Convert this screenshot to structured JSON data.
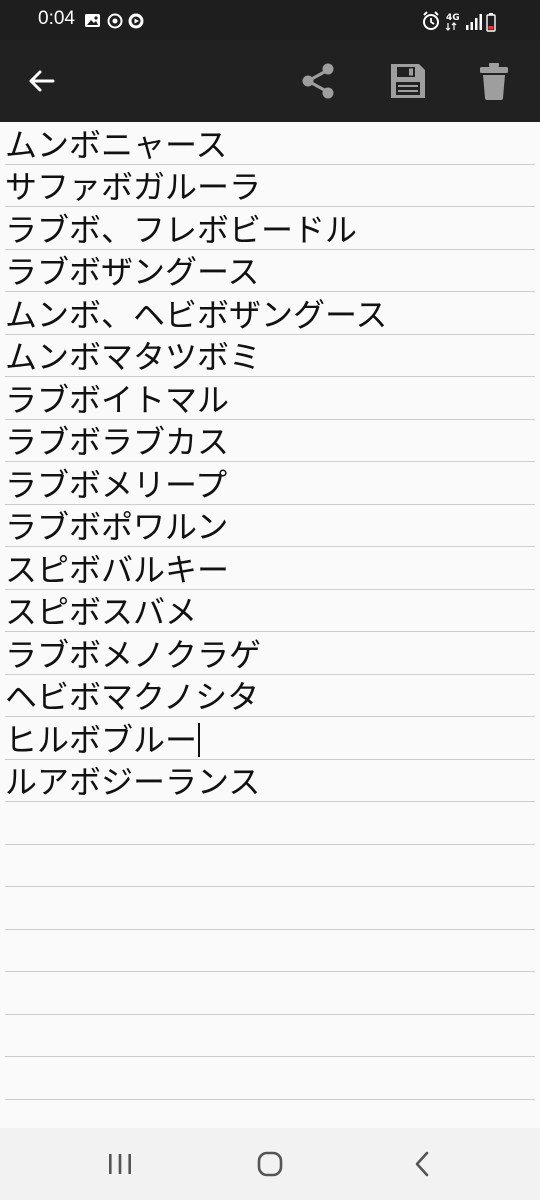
{
  "status_bar": {
    "time": "0:04",
    "network_label": "4G",
    "icons": [
      "gallery-icon",
      "sync-icon",
      "media-icon",
      "alarm-icon",
      "network-4g-icon",
      "signal-icon",
      "battery-low-icon"
    ]
  },
  "app_bar": {
    "icons": [
      "back-arrow-icon",
      "share-icon",
      "save-floppy-icon",
      "trash-icon"
    ]
  },
  "note": {
    "lines": [
      "ムンボニャース",
      "サファボガルーラ",
      "ラブボ、フレボビードル",
      "ラブボザングース",
      "ムンボ、ヘビボザングース",
      "ムンボマタツボミ",
      "ラブボイトマル",
      "ラブボラブカス",
      "ラブボメリープ",
      "ラブボポワルン",
      "スピボバルキー",
      "スピボスバメ",
      "ラブボメノクラゲ",
      "ヘビボマクノシタ",
      "ヒルボブルー",
      "ルアボジーランス"
    ],
    "cursor_line_index": 14,
    "empty_ruled_lines": 8
  },
  "nav_bar": {
    "icons": [
      "recents-icon",
      "home-icon",
      "nav-back-icon"
    ]
  },
  "colors": {
    "status_bar_bg": "#1e1e1e",
    "app_bar_bg": "#212121",
    "icon_grey": "#9e9e9e",
    "page_bg": "#fafafa",
    "rule": "#cdcdcd",
    "battery_low": "#e53935"
  }
}
